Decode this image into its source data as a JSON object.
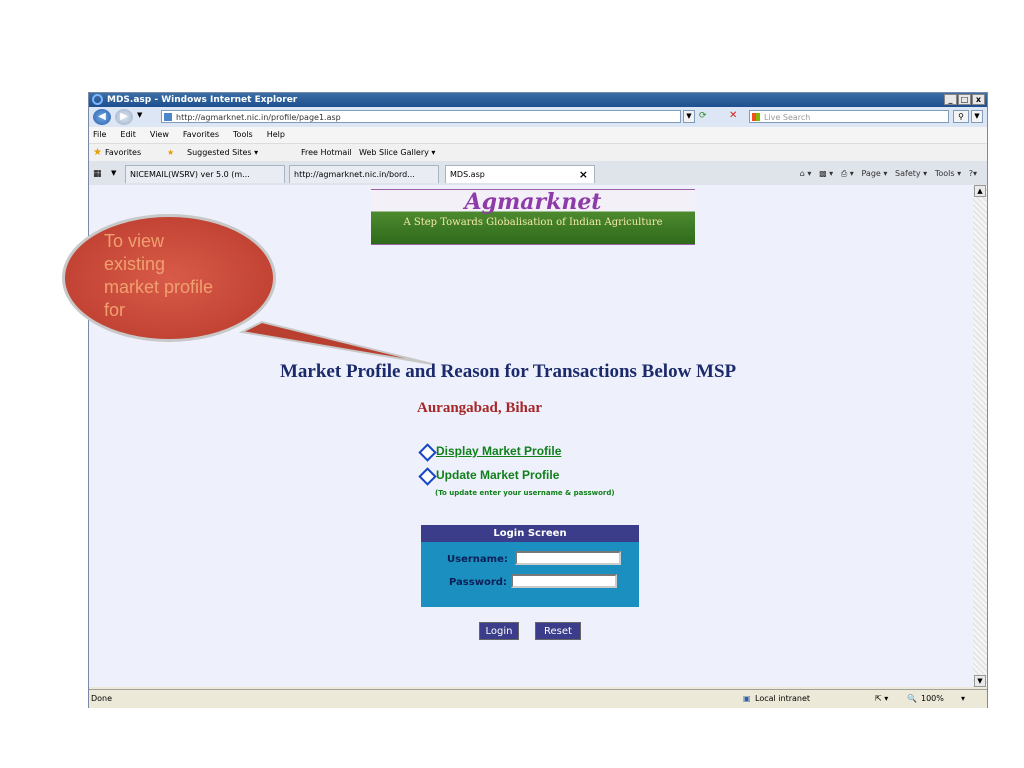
{
  "window": {
    "title": "MDS.asp - Windows Internet Explorer",
    "controls": [
      "_",
      "□",
      "x"
    ]
  },
  "address_bar": {
    "url": "http://agmarknet.nic.in/profile/page1.asp",
    "search_placeholder": "Live Search"
  },
  "menu": [
    "File",
    "Edit",
    "View",
    "Favorites",
    "Tools",
    "Help"
  ],
  "favorites_bar": {
    "label": "Favorites",
    "items": [
      "Suggested Sites ▾",
      "Free Hotmail",
      "Web Slice Gallery ▾"
    ]
  },
  "tabs": [
    {
      "label": "NICEMAIL(WSRV) ver 5.0 (m..."
    },
    {
      "label": "http://agmarknet.nic.in/bord..."
    },
    {
      "label": "MDS.asp"
    }
  ],
  "command_bar": [
    "Page ▾",
    "Safety ▾",
    "Tools ▾"
  ],
  "page": {
    "logo": "Agmarknet",
    "tagline": "A Step Towards Globalisation of Indian Agriculture",
    "heading": "Market Profile and Reason for Transactions Below MSP",
    "location": "Aurangabad, Bihar",
    "links": {
      "display": "Display Market Profile",
      "update": "Update Market Profile",
      "update_note": "(To update enter your username & password)"
    },
    "login": {
      "title": "Login Screen",
      "username_label": "Username:",
      "password_label": "Password:",
      "login_button": "Login",
      "reset_button": "Reset"
    }
  },
  "callout": {
    "text": "To view existing market profile for"
  },
  "status_bar": {
    "status": "Done",
    "zone": "Local intranet",
    "zoom": "100%"
  }
}
